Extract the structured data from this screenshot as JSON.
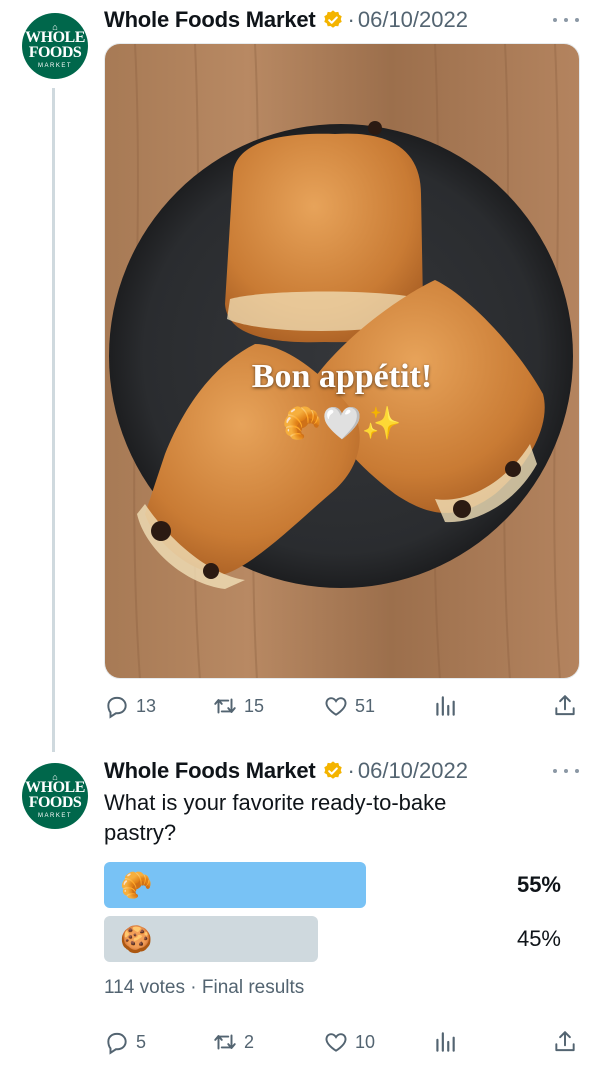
{
  "posts": [
    {
      "author": {
        "name": "Whole Foods Market",
        "avatar_text": [
          "WHOLE",
          "FOODS",
          "MARKET"
        ],
        "verified": true
      },
      "separator": "·",
      "date": "06/10/2022",
      "media": {
        "overlay_text": "Bon appétit!",
        "overlay_emojis": "🥐🤍✨"
      },
      "stats": {
        "replies": "13",
        "reposts": "15",
        "likes": "51"
      }
    },
    {
      "author": {
        "name": "Whole Foods Market",
        "avatar_text": [
          "WHOLE",
          "FOODS",
          "MARKET"
        ],
        "verified": true
      },
      "separator": "·",
      "date": "06/10/2022",
      "text": "What is your favorite ready-to-bake pastry?",
      "poll": {
        "options": [
          {
            "emoji": "🥐",
            "percent": "55%",
            "winner": true
          },
          {
            "emoji": "🍪",
            "percent": "45%",
            "winner": false
          }
        ],
        "footer": "114 votes · Final results"
      },
      "stats": {
        "replies": "5",
        "reposts": "2",
        "likes": "10"
      }
    }
  ],
  "colors": {
    "verified_badge": "#f4b400",
    "poll_winner": "#78c2f5",
    "poll_other": "#cfd9de",
    "avatar_bg": "#00674b",
    "secondary_text": "#536471"
  }
}
